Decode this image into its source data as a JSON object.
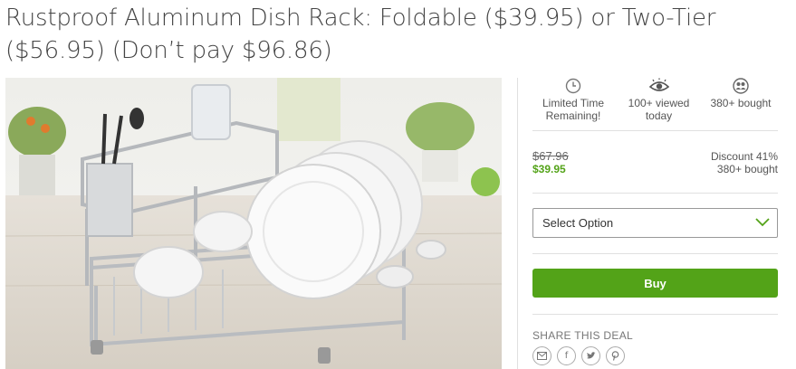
{
  "deal": {
    "title": "Rustproof Aluminum Dish Rack: Foldable ($39.95) or Two-Tier ($56.95) (Don’t pay $96.86)"
  },
  "stats": [
    {
      "icon": "clock-icon",
      "label": "Limited Time Remaining!"
    },
    {
      "icon": "eye-icon",
      "label": "100+ viewed today"
    },
    {
      "icon": "people-icon",
      "label": "380+ bought"
    }
  ],
  "pricing": {
    "original": "$67.96",
    "current": "$39.95",
    "discount": "Discount 41%",
    "bought": "380+ bought"
  },
  "option_select": {
    "selected": "Select Option",
    "icon": "chevron-down-icon"
  },
  "buy_button": {
    "label": "Buy"
  },
  "share": {
    "title": "SHARE THIS DEAL",
    "icons": [
      "email-icon",
      "facebook-icon",
      "twitter-icon",
      "pinterest-icon"
    ]
  },
  "colors": {
    "accent": "#53a318",
    "divider": "#e0e0e0"
  }
}
